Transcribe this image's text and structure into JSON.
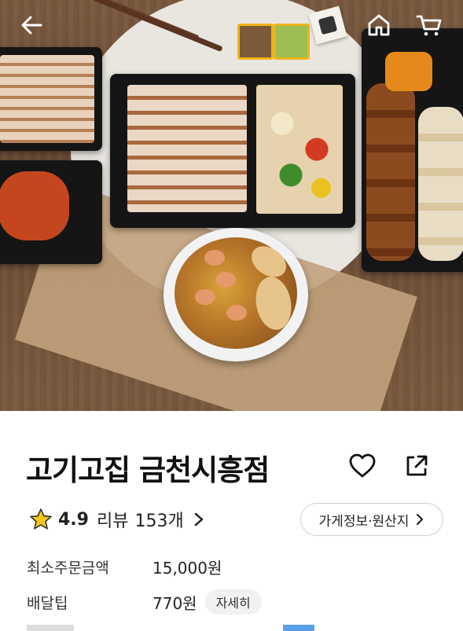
{
  "header": {
    "back_icon": "arrow-left-icon",
    "home_icon": "home-icon",
    "cart_icon": "cart-icon"
  },
  "store": {
    "name": "고기고집 금천시흥점",
    "favorite_icon": "heart-outline-icon",
    "share_icon": "share-icon"
  },
  "rating": {
    "star_icon": "star-icon",
    "value": "4.9",
    "review_label": "리뷰",
    "review_count": "153개"
  },
  "info_button": {
    "label": "가게정보·원산지"
  },
  "details": {
    "min_order_label": "최소주문금액",
    "min_order_value": "15,000원",
    "delivery_tip_label": "배달팁",
    "delivery_tip_value": "770원",
    "more_label": "자세히"
  },
  "colors": {
    "star": "#f5c518",
    "text": "#1a1a1a",
    "pill_bg": "#f1f1f1"
  }
}
